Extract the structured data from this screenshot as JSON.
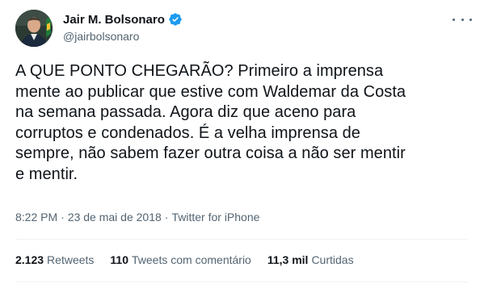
{
  "author": {
    "display_name": "Jair M. Bolsonaro",
    "handle": "@jairbolsonaro",
    "verified": true,
    "avatar_icon": "profile-photo",
    "verified_icon": "verified-badge-icon",
    "verified_color": "#1d9bf0"
  },
  "tweet": {
    "text": "A QUE PONTO CHEGARÃO? Primeiro a imprensa\nmente ao publicar que estive com Waldemar da Costa\nna semana passada. Agora diz que aceno para\ncorruptos e condenados. É a velha imprensa de\nsempre, não sabem fazer outra coisa a não ser mentir\ne mentir.",
    "time": "8:22 PM",
    "date": "23 de mai de 2018",
    "source": "Twitter for iPhone",
    "separator": "·"
  },
  "stats": {
    "retweets_count": "2.123",
    "retweets_label": "Retweets",
    "quotes_count": "110",
    "quotes_label": "Tweets com comentário",
    "likes_count": "11,3 mil",
    "likes_label": "Curtidas"
  },
  "colors": {
    "text": "#0f1419",
    "secondary": "#536471",
    "divider": "#eff3f4"
  }
}
